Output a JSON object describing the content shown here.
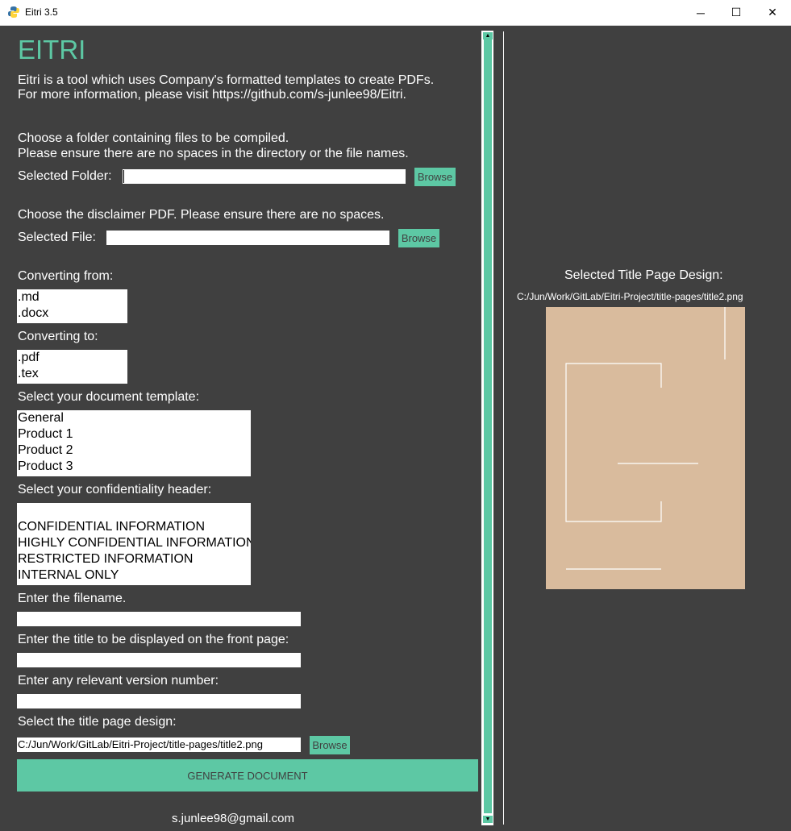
{
  "window": {
    "title": "Eitri 3.5",
    "minimize": "─",
    "maximize": "☐",
    "close": "✕"
  },
  "header": {
    "title": "EITRI",
    "desc1": "Eitri is a tool which uses Company's formatted templates to create PDFs.",
    "desc2": "For more information, please visit https://github.com/s-junlee98/Eitri."
  },
  "folder": {
    "instr1": "Choose a folder containing files to be compiled.",
    "instr2": "Please ensure there are no spaces in the directory or the file names.",
    "label": "Selected Folder:",
    "value": "",
    "browse": "Browse"
  },
  "disclaimer": {
    "instr": "Choose the disclaimer PDF. Please ensure there are no spaces.",
    "label": "Selected File:",
    "value": "",
    "browse": "Browse"
  },
  "converting_from": {
    "label": "Converting from:",
    "options": [
      ".md",
      ".docx"
    ]
  },
  "converting_to": {
    "label": "Converting to:",
    "options": [
      ".pdf",
      ".tex"
    ]
  },
  "template": {
    "label": "Select your document template:",
    "options": [
      "General",
      "Product 1",
      "Product 2",
      "Product 3"
    ]
  },
  "confidentiality": {
    "label": "Select your confidentiality header:",
    "options": [
      "",
      "CONFIDENTIAL INFORMATION",
      "HIGHLY CONFIDENTIAL INFORMATION",
      "RESTRICTED INFORMATION",
      "INTERNAL ONLY"
    ]
  },
  "filename": {
    "label": "Enter the filename.",
    "value": ""
  },
  "front_title": {
    "label": "Enter the title to be displayed on the front page:",
    "value": ""
  },
  "version": {
    "label": "Enter any relevant version number:",
    "value": ""
  },
  "title_page": {
    "label": "Select the title page design:",
    "value": "C:/Jun/Work/GitLab/Eitri-Project/title-pages/title2.png",
    "browse": "Browse"
  },
  "generate": "GENERATE DOCUMENT",
  "footer_email": "s.junlee98@gmail.com",
  "preview": {
    "heading": "Selected Title Page Design:",
    "path": "C:/Jun/Work/GitLab/Eitri-Project/title-pages/title2.png"
  },
  "colors": {
    "accent": "#5dc8a4",
    "background": "#404040",
    "preview_bg": "#d9bb9d"
  }
}
